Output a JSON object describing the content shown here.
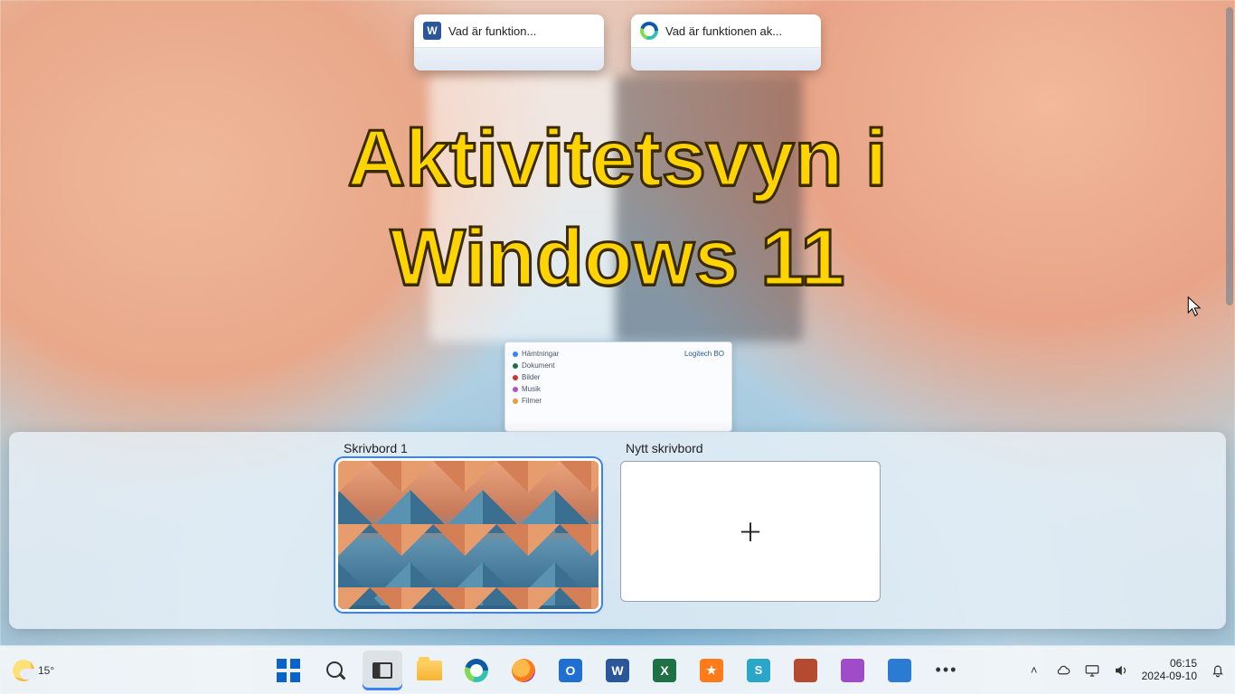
{
  "overlay": {
    "line1": "Aktivitetsvyn i",
    "line2": "Windows 11"
  },
  "taskview": {
    "cards": [
      {
        "app": "Word",
        "title": "Vad är funktion..."
      },
      {
        "app": "Edge",
        "title": "Vad är funktionen ak..."
      }
    ]
  },
  "desktops": {
    "current_label": "Skrivbord 1",
    "new_label": "Nytt skrivbord"
  },
  "weather": {
    "temp": "15°"
  },
  "taskbar_icons": [
    {
      "name": "start-button"
    },
    {
      "name": "search-button"
    },
    {
      "name": "task-view-button"
    },
    {
      "name": "file-explorer-button"
    },
    {
      "name": "edge-button"
    },
    {
      "name": "firefox-button"
    },
    {
      "name": "outlook-button",
      "glyph": "O"
    },
    {
      "name": "word-button",
      "glyph": "W"
    },
    {
      "name": "excel-button",
      "glyph": "X"
    },
    {
      "name": "foxit-reader-button",
      "glyph": "✦"
    },
    {
      "name": "snagit-button",
      "glyph": "S"
    },
    {
      "name": "affinity-publisher-button"
    },
    {
      "name": "affinity-photo-button"
    },
    {
      "name": "affinity-designer-button"
    },
    {
      "name": "overflow-button",
      "glyph": "•••"
    }
  ],
  "tray": {
    "time": "06:15",
    "date": "2024-09-10"
  },
  "explorer_thumb": {
    "right_title": "Logitech BO",
    "rows": [
      "Hämtningar",
      "Dokument",
      "Bilder",
      "Musik",
      "Filmer"
    ]
  }
}
